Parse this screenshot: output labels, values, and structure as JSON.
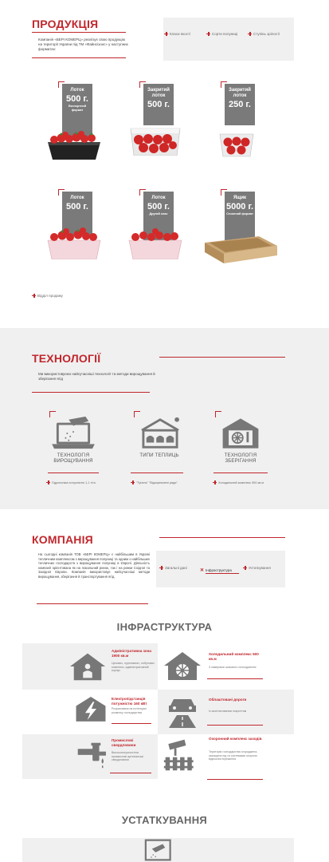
{
  "products": {
    "title": "ПРОДУКЦІЯ",
    "intro": "Компанія «БЕРІ КОМЕРЦ» реалізує свою продукцію на території України під ТМ «Файнсізонс» у наступних форматах:",
    "filters": [
      "Класи якості",
      "Сорти полуниці",
      "Ступінь зрілості"
    ],
    "items": [
      {
        "type": "Лоток",
        "weight": "500 г.",
        "sub": "Експортний формат"
      },
      {
        "type": "Закритий лоток",
        "weight": "500 г.",
        "sub": ""
      },
      {
        "type": "Закритий лоток",
        "weight": "250 г.",
        "sub": ""
      },
      {
        "type": "Лоток",
        "weight": "500 г.",
        "sub": ""
      },
      {
        "type": "Лоток",
        "weight": "500 г.",
        "sub": "Другий клас"
      },
      {
        "type": "Ящик",
        "weight": "5000 г.",
        "sub": "Сезонний формат"
      }
    ],
    "sales_link": "Відділ продажу"
  },
  "tech": {
    "title": "ТЕХНОЛОГІЇ",
    "intro": "Ми використовуємо найсучасніші технології та методи вирощування й зберігання ягід",
    "items": [
      {
        "title": "ТЕХНОЛОГІЯ ВИРОЩУВАННЯ",
        "note": "Гідропоніка потужністю 1,1 т/га",
        "icon": "laptop-watering-icon"
      },
      {
        "title": "ТИПИ ТЕПЛИЦЬ",
        "note": "\"Тунель\" \"Відокремлені ряди\"",
        "icon": "greenhouse-icon"
      },
      {
        "title": "ТЕХНОЛОГІЯ ЗБЕРІГАННЯ",
        "note": "Холодильний комплекс 500 кв.м",
        "icon": "cold-storage-icon"
      }
    ]
  },
  "company": {
    "title": "КОМПАНІЯ",
    "intro": "На сьогодні компанія ТОВ «БЕРІ КОМЕРЦ» є найбільшим в Україні тепличним комплексом з вирощування полуниці та одним з найбільших тепличних господарств з вирощування полуниці в Європі. Діяльність компанії орієнтована як на локальний ринок, так і на ринки Східної та Західної Європи. Компанія використовує найсучасніші методи вирощування, зберігання й транспортування ягід.",
    "tabs": [
      "Загальні дані",
      "Інфраструктура",
      "Устаткування"
    ]
  },
  "infra": {
    "title": "ІНФРАСТРУКТУРА",
    "items": [
      {
        "title": "Адміністративна зона 1900 кв.м",
        "desc": "Цехових, пуртливних, побутових комплекс, адміністративний корпус",
        "icon": "house-person-icon"
      },
      {
        "title": "Холодильний комплекс 500 кв.м",
        "desc": "З камерами шокового охолодження",
        "icon": "house-fan-icon"
      },
      {
        "title": "Електропідстанція потужністю 160 кВт",
        "desc": "Розрахована на потенціал розвитку господарства",
        "icon": "lightning-icon"
      },
      {
        "title": "Облаштовані дороги",
        "desc": "Із зазтільтованим покриттям",
        "icon": "road-car-icon"
      },
      {
        "title": "Промислові свердловини",
        "desc": "Високопотужностіна промислові артезіанські свердловини",
        "icon": "water-tap-icon"
      },
      {
        "title": "Охоронний комплекс заходів",
        "desc": "Територія господарства огороджена, захищена під та системами охорони відеоспостереження",
        "icon": "camera-fence-icon"
      }
    ]
  },
  "equipment": {
    "title": "УСТАТКУВАННЯ"
  }
}
